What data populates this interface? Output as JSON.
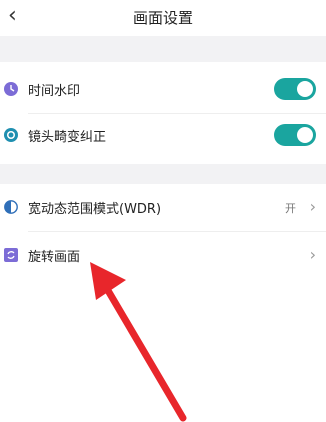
{
  "header": {
    "title": "画面设置"
  },
  "group1": {
    "items": [
      {
        "label": "时间水印",
        "on": true
      },
      {
        "label": "镜头畸变纠正",
        "on": true
      }
    ]
  },
  "group2": {
    "items": [
      {
        "label": "宽动态范围模式(WDR)",
        "value": "开"
      },
      {
        "label": "旋转画面"
      }
    ]
  },
  "colors": {
    "accent": "#1aa59f",
    "icon": "#7c6cd6",
    "annotation": "#e8262b"
  }
}
